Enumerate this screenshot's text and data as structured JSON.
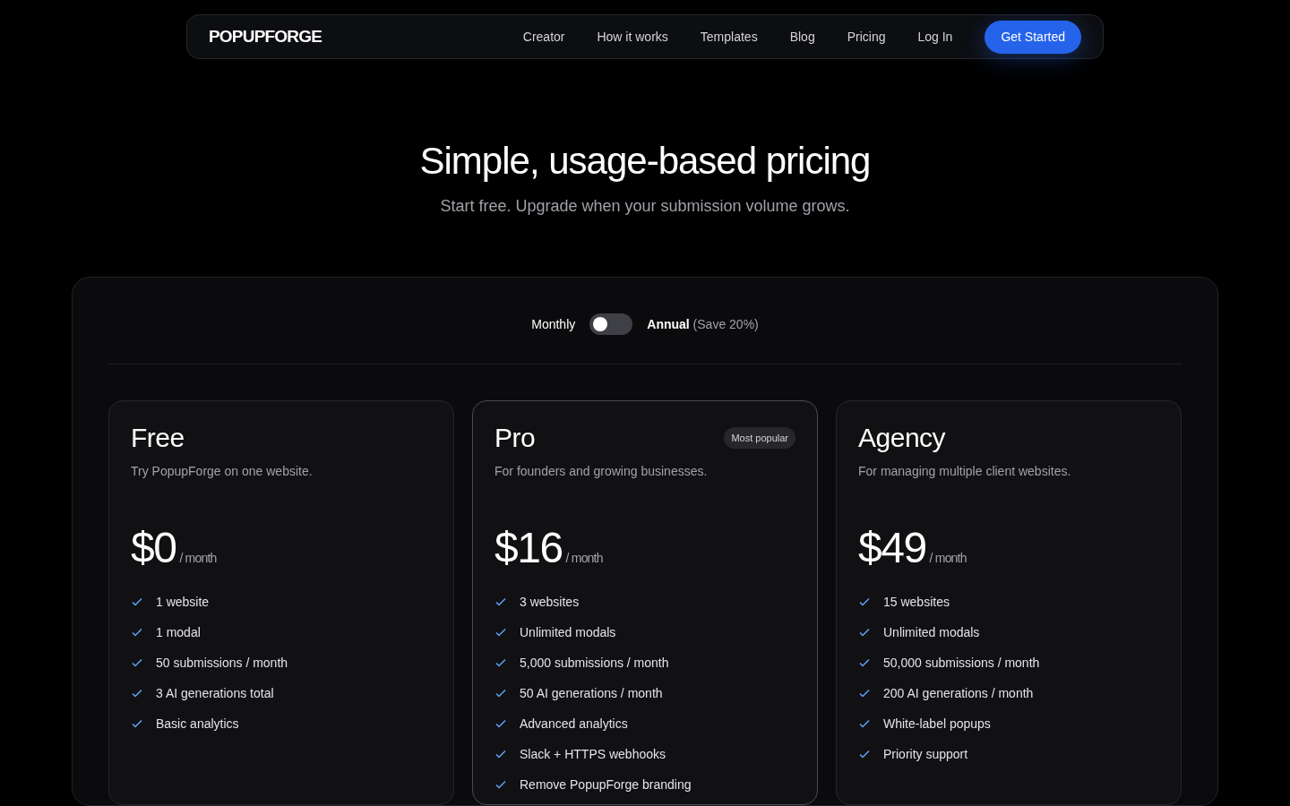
{
  "nav": {
    "logo": "POPUPFORGE",
    "links": [
      "Creator",
      "How it works",
      "Templates",
      "Blog",
      "Pricing",
      "Log In"
    ],
    "cta": "Get Started"
  },
  "hero": {
    "title": "Simple, usage-based pricing",
    "subtitle": "Start free. Upgrade when your submission volume grows."
  },
  "billing": {
    "monthly_label": "Monthly",
    "annual_label": "Annual",
    "annual_note": "(Save 20%)",
    "on": false
  },
  "plans": [
    {
      "name": "Free",
      "description": "Try PopupForge on one website.",
      "price": "$0",
      "period": "/ month",
      "selected": false,
      "features": [
        "1 website",
        "1 modal",
        "50 submissions / month",
        "3 AI generations total",
        "Basic analytics"
      ]
    },
    {
      "name": "Pro",
      "badge": "Most popular",
      "description": "For founders and growing businesses.",
      "price": "$16",
      "period": "/ month",
      "selected": true,
      "features": [
        "3 websites",
        "Unlimited modals",
        "5,000 submissions / month",
        "50 AI generations / month",
        "Advanced analytics",
        "Slack + HTTPS webhooks",
        "Remove PopupForge branding"
      ]
    },
    {
      "name": "Agency",
      "description": "For managing multiple client websites.",
      "price": "$49",
      "period": "/ month",
      "selected": false,
      "features": [
        "15 websites",
        "Unlimited modals",
        "50,000 submissions / month",
        "200 AI generations / month",
        "White-label popups",
        "Priority support"
      ]
    }
  ]
}
